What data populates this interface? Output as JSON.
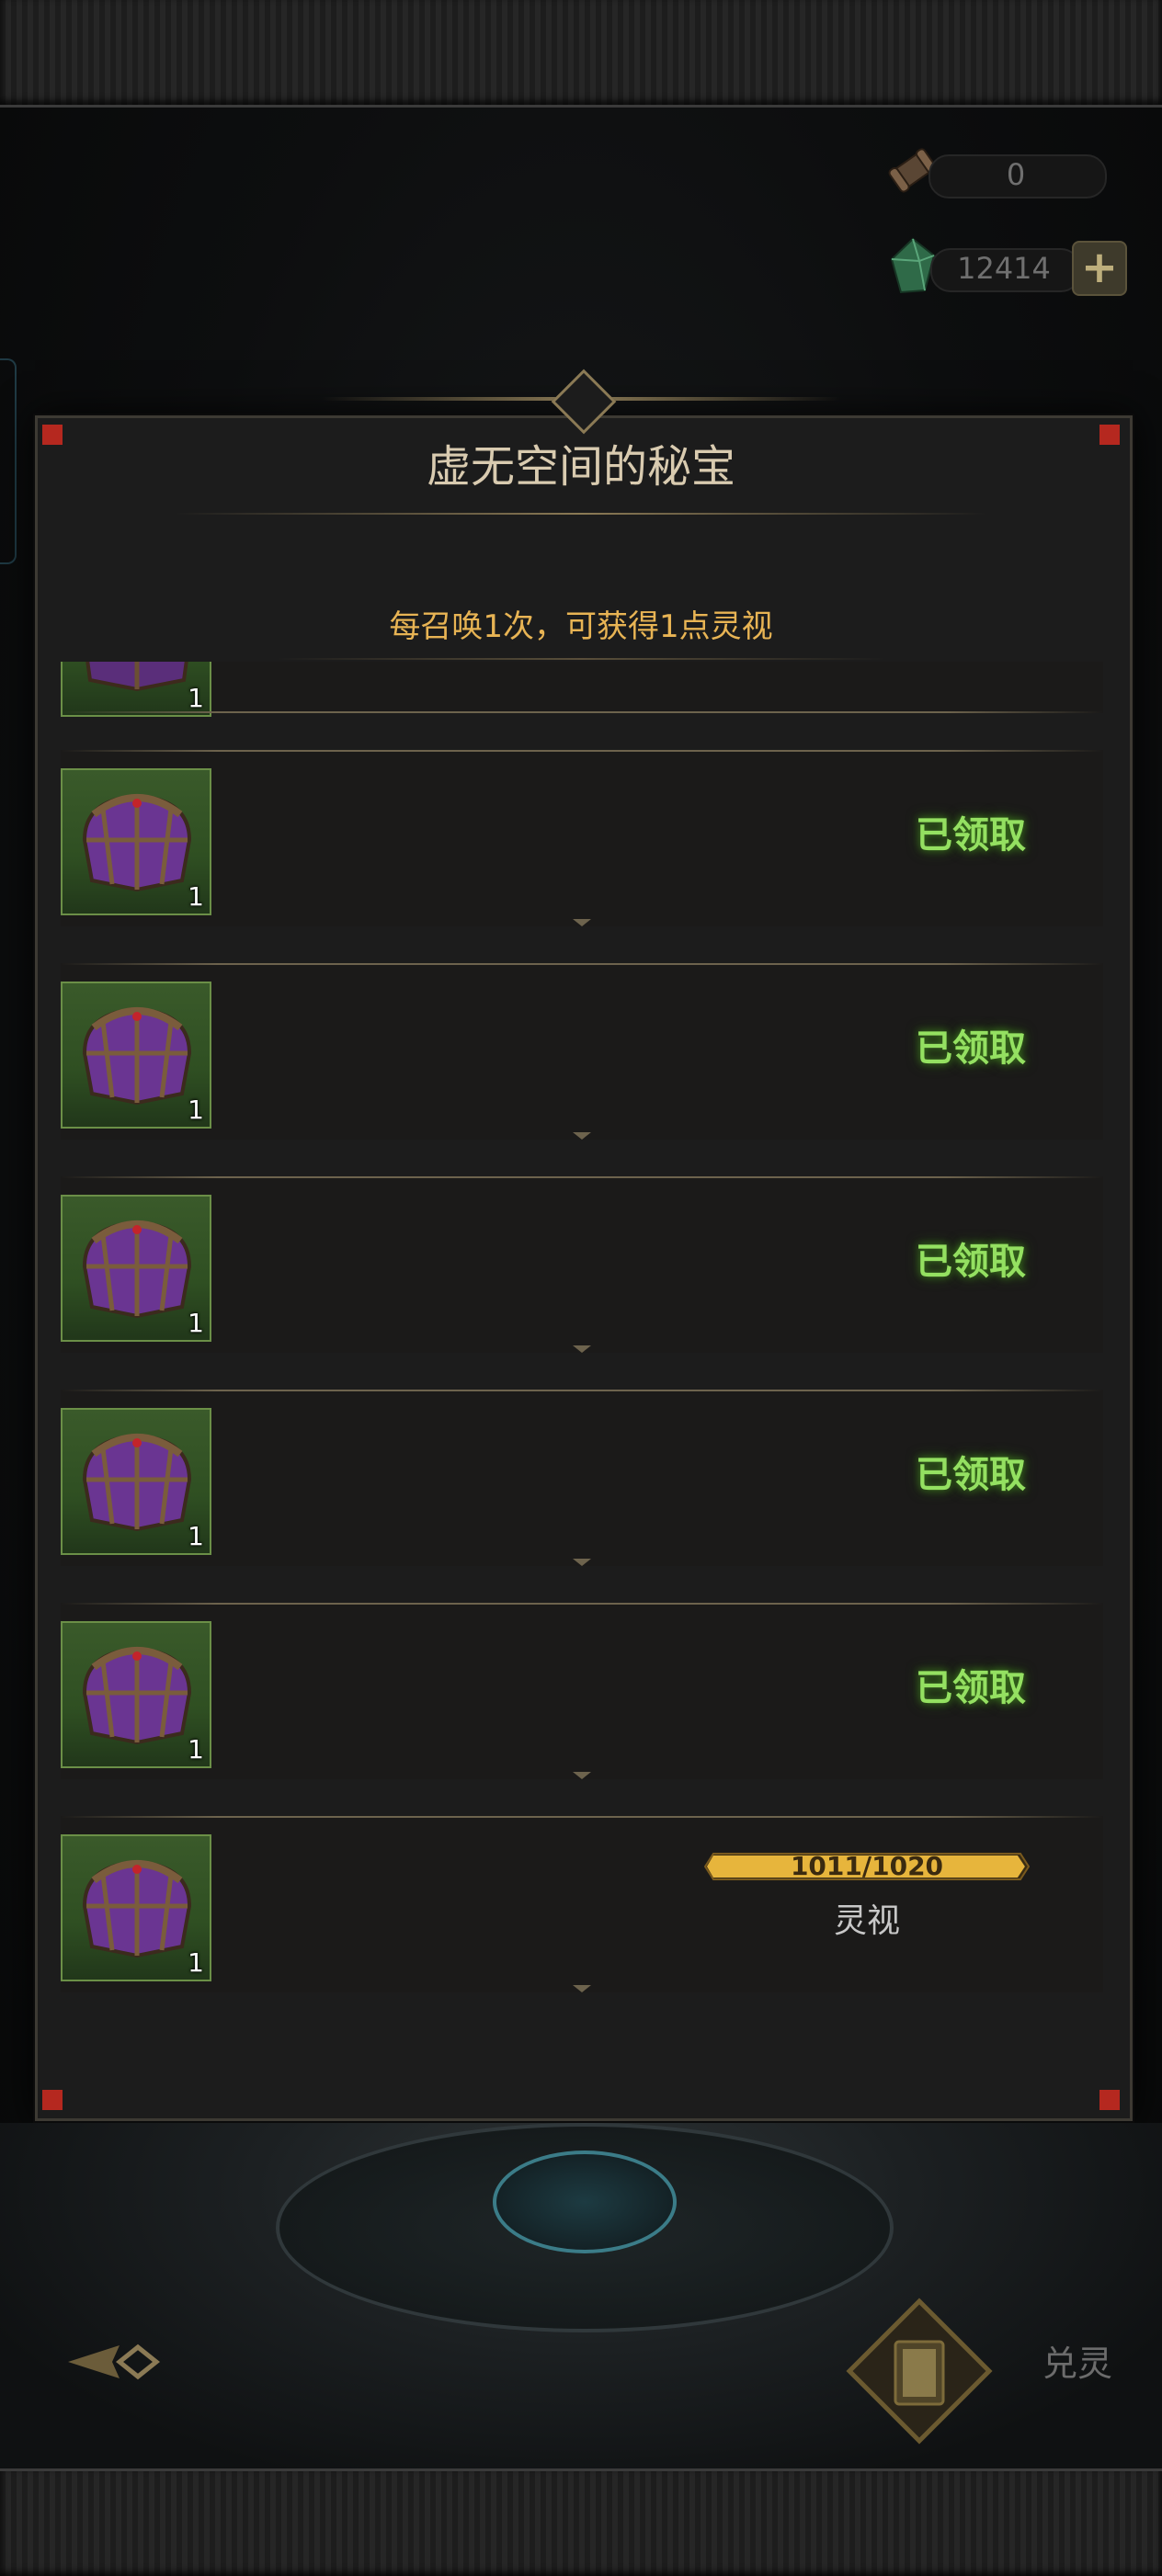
{
  "currency": {
    "scroll_count": "0",
    "gem_count": "12414",
    "plus_label": "+"
  },
  "dialog": {
    "title": "虚无空间的秘宝",
    "subtitle": "每召唤1次，可获得1点灵视"
  },
  "rewards": [
    {
      "qty": "1",
      "status": "已领取"
    },
    {
      "qty": "1",
      "status": "已领取"
    },
    {
      "qty": "1",
      "status": "已领取"
    },
    {
      "qty": "1",
      "status": "已领取"
    },
    {
      "qty": "1",
      "status": "已领取"
    },
    {
      "qty": "1",
      "progress_text": "1011/1020",
      "progress_value": 1011,
      "progress_max": 1020,
      "progress_label": "灵视"
    }
  ],
  "partial_row": {
    "qty": "1"
  },
  "bottom": {
    "exchange_label": "兑灵"
  },
  "colors": {
    "claimed_green": "#94e061",
    "subtitle_gold": "#e8b454",
    "progress_gold": "#e7b53c"
  }
}
